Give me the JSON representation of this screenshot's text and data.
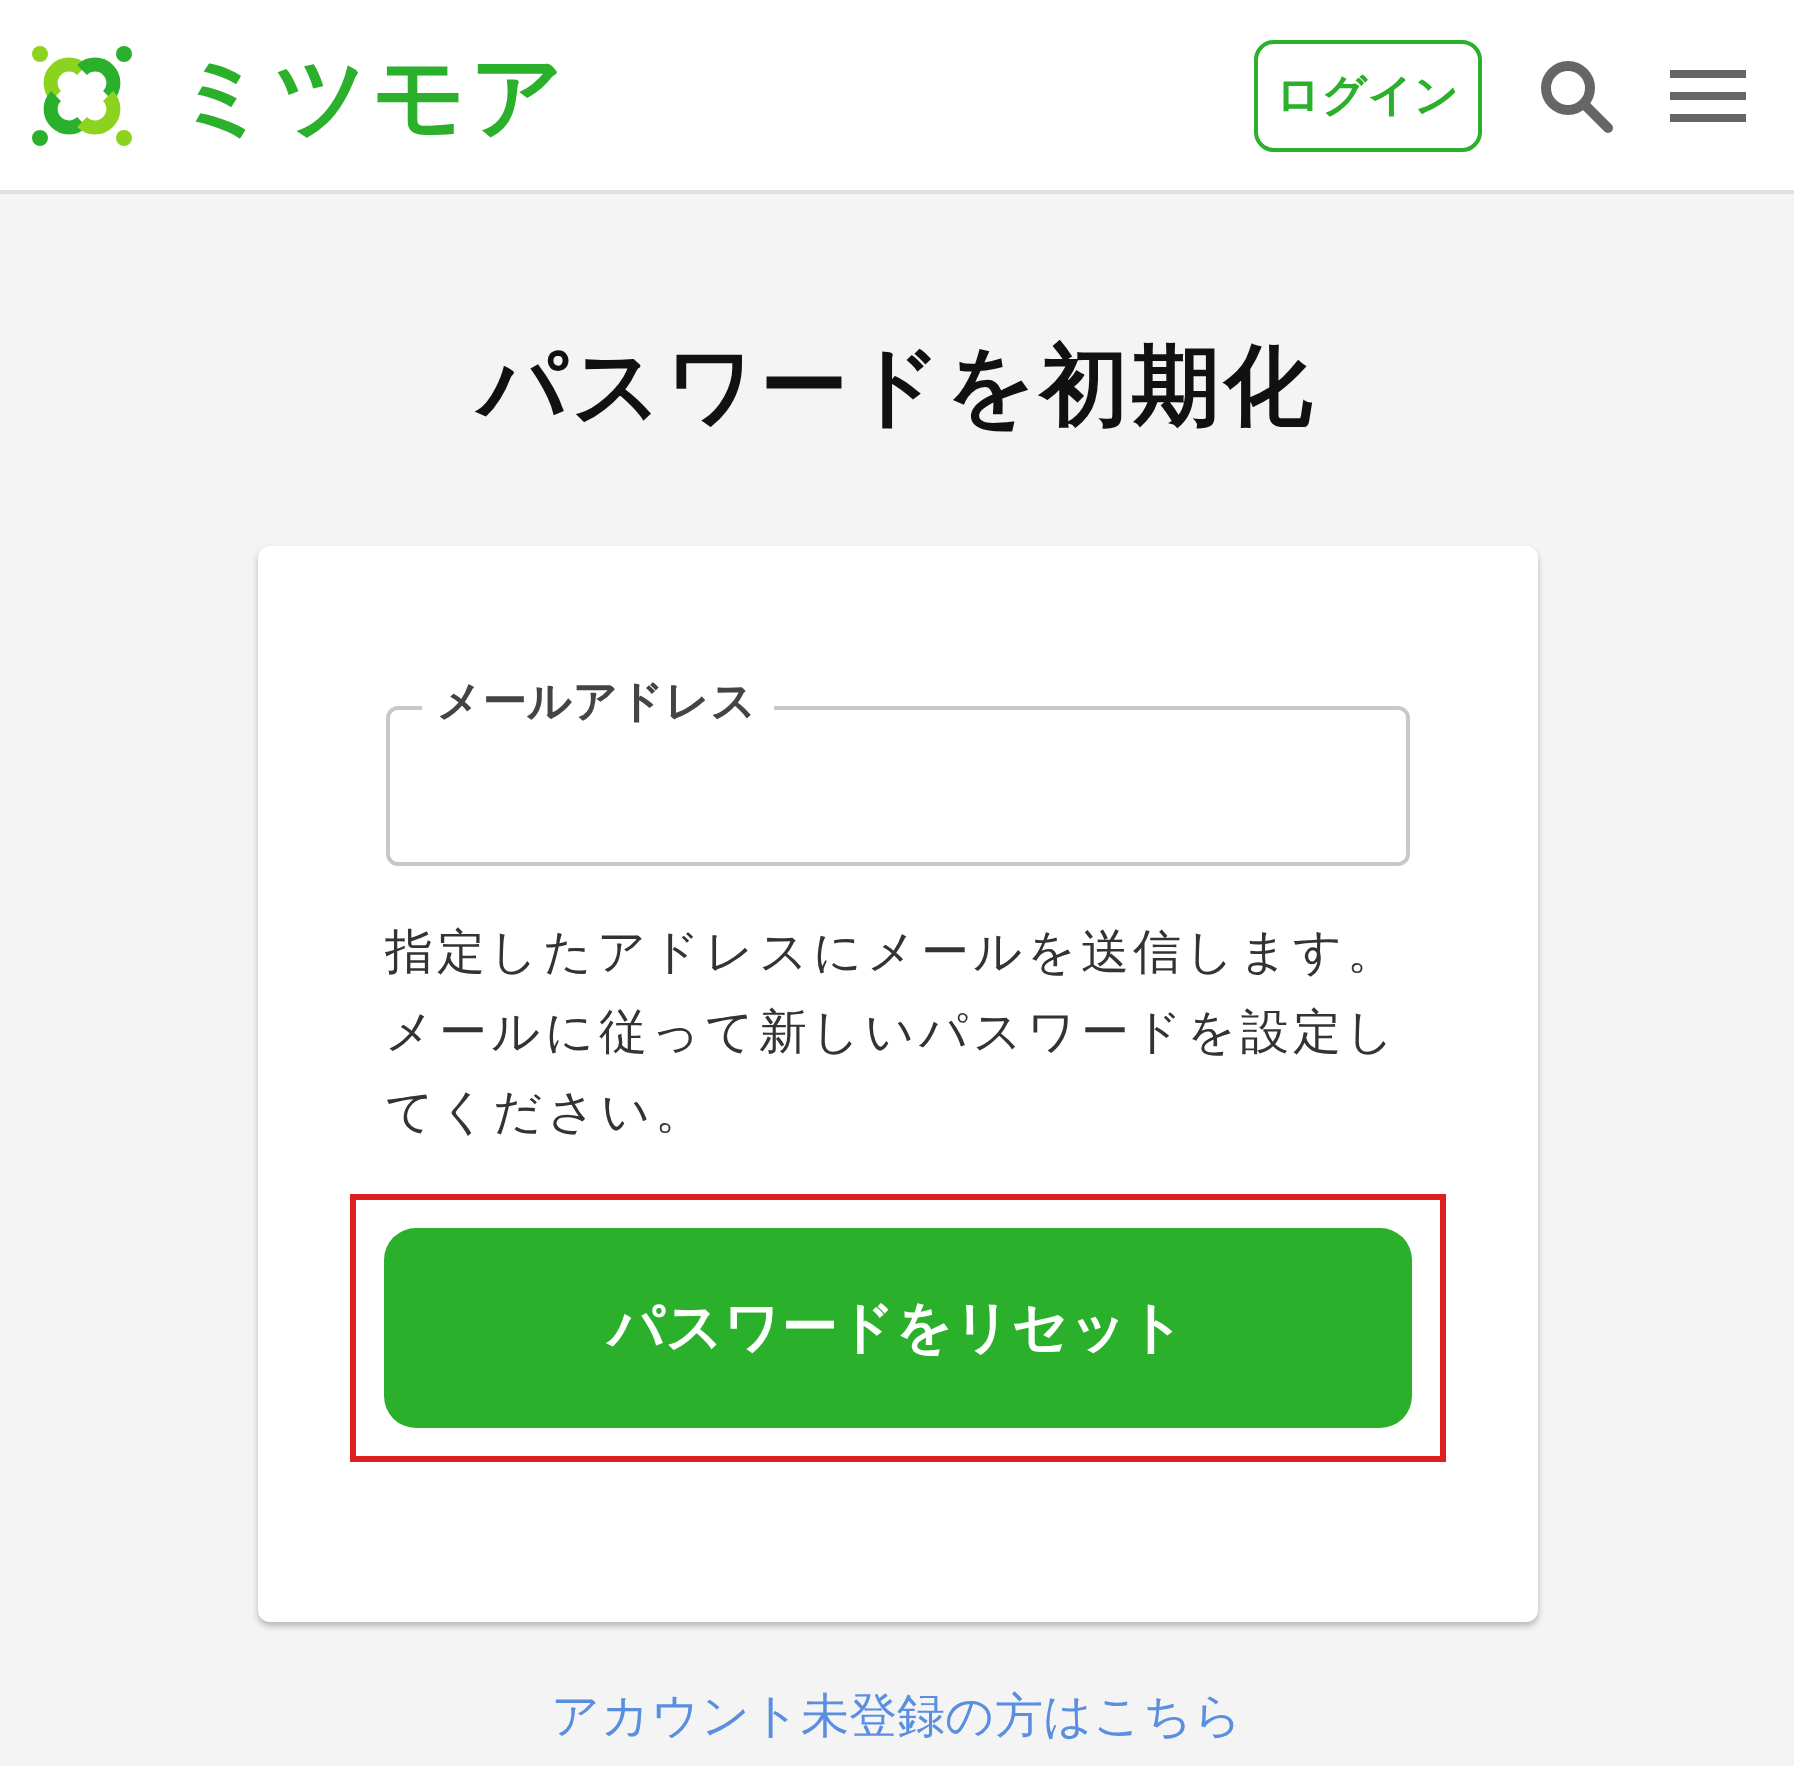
{
  "header": {
    "logo_text": "ミツモア",
    "login_button": "ログイン"
  },
  "title": "パスワードを初期化",
  "form": {
    "email_field": {
      "label": "メールアドレス"
    },
    "description": "指定したアドレスにメールを送信します。メールに従って新しいパスワードを設定してください。",
    "reset_button": {
      "label": "パスワードをリセット",
      "highlighted": true
    }
  },
  "signup_link": "アカウント未登録の方はこちら"
}
